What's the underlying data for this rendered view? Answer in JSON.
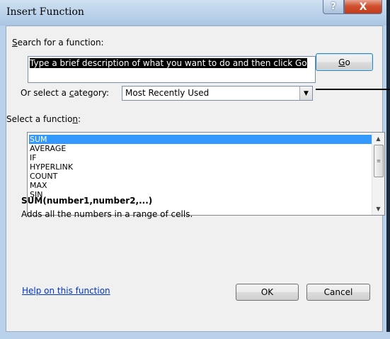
{
  "window": {
    "title": "Insert Function",
    "help_glyph": "?",
    "close_glyph": "X"
  },
  "search": {
    "label_prefix": "",
    "label_accel": "S",
    "label_rest": "earch for a function:",
    "value": "Type a brief description of what you want to do and then click Go",
    "go_accel": "G",
    "go_rest": "o"
  },
  "category": {
    "label_prefix": "Or select a ",
    "label_accel": "c",
    "label_rest": "ategory:",
    "selected": "Most Recently Used"
  },
  "functions": {
    "label_prefix": "Select a functio",
    "label_accel": "n",
    "label_rest": ":",
    "items": [
      "SUM",
      "AVERAGE",
      "IF",
      "HYPERLINK",
      "COUNT",
      "MAX",
      "SIN"
    ],
    "selected_index": 0
  },
  "details": {
    "signature": "SUM(number1,number2,...)",
    "description": "Adds all the numbers in a range of cells."
  },
  "footer": {
    "help_link": "Help on this function",
    "ok_label": "OK",
    "cancel_label": "Cancel"
  },
  "colors": {
    "selection": "#3399ff",
    "link": "#0033cc",
    "title_bar": "#b9d1ea",
    "close_button": "#c23c1b"
  }
}
